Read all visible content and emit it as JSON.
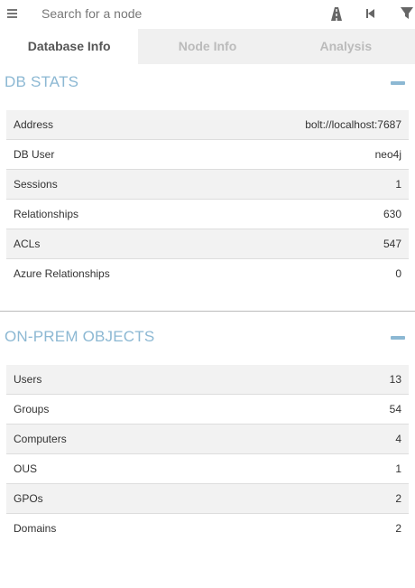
{
  "search": {
    "placeholder": "Search for a node"
  },
  "toolbar": {
    "menu_icon": "hamburger-menu-icon",
    "pathfinding_icon": "road-icon",
    "back_icon": "step-backward-icon",
    "filter_icon": "filter-icon"
  },
  "tabs": [
    {
      "label": "Database Info",
      "active": true
    },
    {
      "label": "Node Info",
      "active": false
    },
    {
      "label": "Analysis",
      "active": false
    }
  ],
  "colors": {
    "section_title": "#8cb8d3",
    "row_stripe": "#f2f2f2"
  },
  "db_stats": {
    "title": "DB STATS",
    "rows": [
      {
        "label": "Address",
        "value": "bolt://localhost:7687"
      },
      {
        "label": "DB User",
        "value": "neo4j"
      },
      {
        "label": "Sessions",
        "value": "1"
      },
      {
        "label": "Relationships",
        "value": "630"
      },
      {
        "label": "ACLs",
        "value": "547"
      },
      {
        "label": "Azure Relationships",
        "value": "0"
      }
    ]
  },
  "onprem": {
    "title": "ON-PREM OBJECTS",
    "rows": [
      {
        "label": "Users",
        "value": "13"
      },
      {
        "label": "Groups",
        "value": "54"
      },
      {
        "label": "Computers",
        "value": "4"
      },
      {
        "label": "OUS",
        "value": "1"
      },
      {
        "label": "GPOs",
        "value": "2"
      },
      {
        "label": "Domains",
        "value": "2"
      }
    ]
  }
}
